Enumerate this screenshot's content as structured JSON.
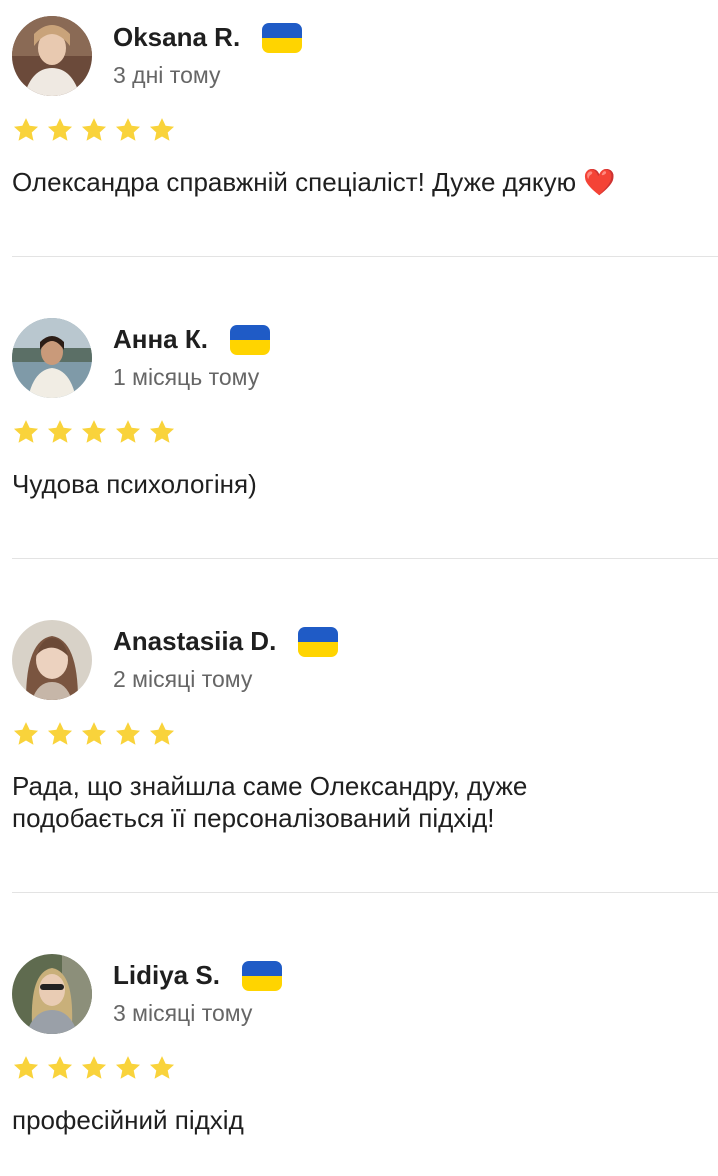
{
  "colors": {
    "star": "#F9D33B",
    "flag_blue": "#1F5BC6",
    "flag_yellow": "#FFD400",
    "divider": "#E3E3E3",
    "date_text": "#666666"
  },
  "reviews": [
    {
      "name": "Oksana R.",
      "date": "3 дні тому",
      "rating": 5,
      "text": "Олександра справжній спеціаліст! Дуже дякую",
      "emoji": "❤️",
      "avatar_icon": "user-photo-avatar"
    },
    {
      "name": "Анна К.",
      "date": "1 місяць тому",
      "rating": 5,
      "text": "Чудова психологіня)",
      "avatar_icon": "user-photo-avatar"
    },
    {
      "name": "Anastasiia D.",
      "date": "2 місяці тому",
      "rating": 5,
      "text": "Рада, що знайшла саме Олександру, дуже подобається її персоналізований підхід!",
      "avatar_icon": "user-photo-avatar"
    },
    {
      "name": "Lidiya S.",
      "date": "3 місяці тому",
      "rating": 5,
      "text": "професійний підхід",
      "avatar_icon": "user-photo-avatar"
    }
  ]
}
